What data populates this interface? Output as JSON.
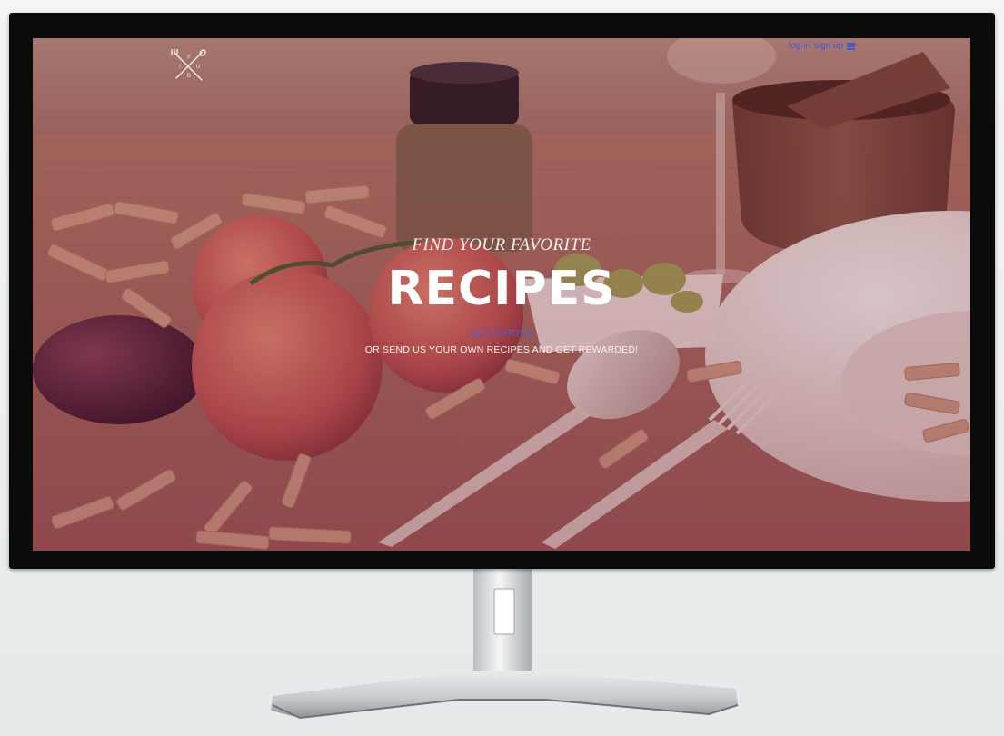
{
  "logo": {
    "letters": [
      "F",
      "I",
      "U",
      "D"
    ],
    "icon": "crossed-fork-spoon-logo"
  },
  "nav": {
    "login_label": "log in",
    "signup_label": "sign up",
    "menu_icon": "hamburger-menu-icon"
  },
  "hero": {
    "kicker": "FIND YOUR FAVORITE",
    "headline": "RECIPES",
    "cta_label": "GET STARTED",
    "subtitle": "OR SEND US YOUR OWN RECIPES AND GET REWARDED!"
  },
  "colors": {
    "link": "#3c5ad8",
    "headline": "#ffffff",
    "bezel": "#0b0b0b",
    "tint": "#7a3e46"
  }
}
